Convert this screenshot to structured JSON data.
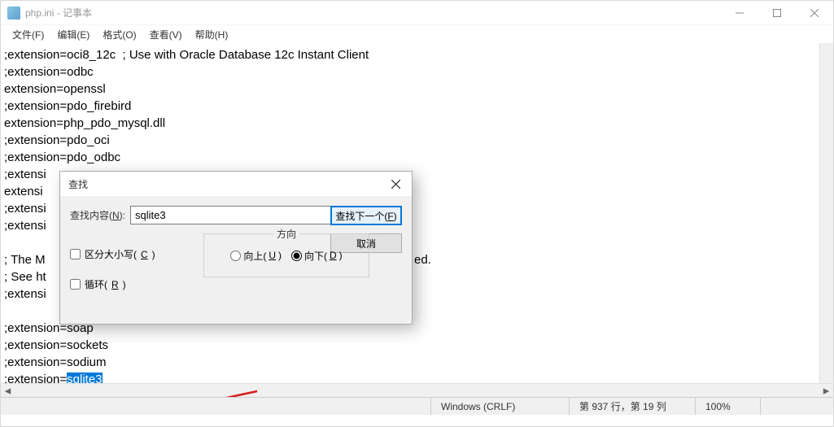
{
  "window": {
    "title": "php.ini - 记事本",
    "menus": [
      "文件(F)",
      "编辑(E)",
      "格式(O)",
      "查看(V)",
      "帮助(H)"
    ]
  },
  "editor": {
    "lines_pre": [
      ";extension=oci8_12c  ; Use with Oracle Database 12c Instant Client",
      ";extension=odbc",
      "extension=openssl",
      ";extension=pdo_firebird",
      "extension=php_pdo_mysql.dll",
      ";extension=pdo_oci",
      ";extension=pdo_odbc",
      ";extensi",
      "extensi",
      ";extensi",
      ";extensi",
      "",
      "; The M",
      "; See ht",
      ";extensi",
      "",
      ";extension=soap",
      ";extension=sockets",
      ";extension=sodium"
    ],
    "last_line_prefix": ";extension=",
    "highlighted": "sqlite3",
    "obscured_right": "ed."
  },
  "find_dialog": {
    "title": "查找",
    "label": "查找内容(N):",
    "value": "sqlite3",
    "find_next": "查找下一个(F)",
    "cancel": "取消",
    "direction_legend": "方向",
    "radio_up": "向上(U)",
    "radio_down": "向下(D)",
    "checkbox_case": "区分大小写(C)",
    "checkbox_wrap": "循环(R)"
  },
  "statusbar": {
    "encoding": "Windows (CRLF)",
    "position": "第 937 行，第 19 列",
    "zoom": "100%"
  }
}
